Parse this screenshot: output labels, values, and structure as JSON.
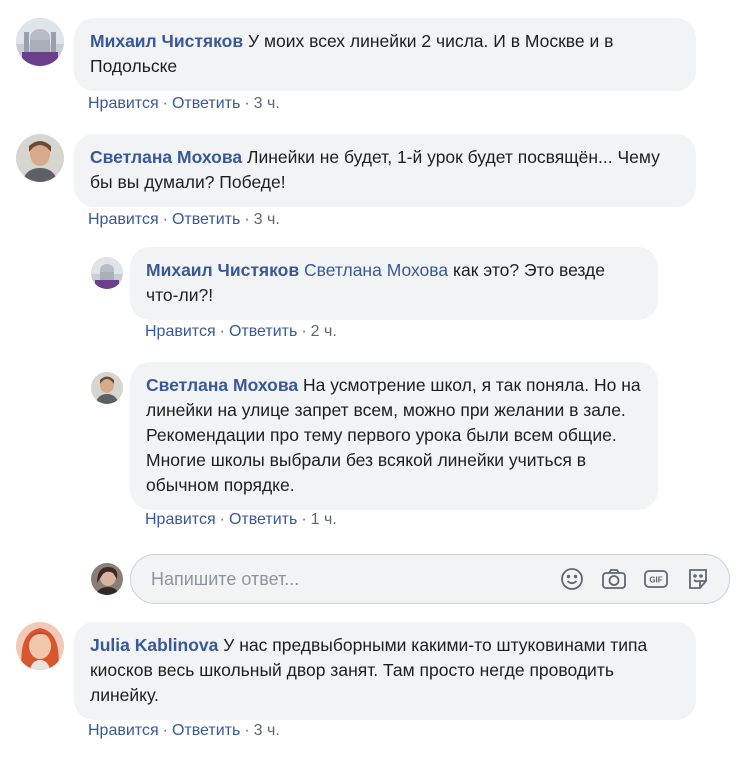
{
  "comments": [
    {
      "author": "Михаил Чистяков",
      "text": "У моих всех линейки 2 числа. И в Москве и в Подольске",
      "like": "Нравится",
      "reply": "Ответить",
      "time": "3 ч."
    },
    {
      "author": "Светлана Мохова",
      "text": "Линейки не будет, 1-й урок будет посвящён... Чему бы вы думали? Победе!",
      "like": "Нравится",
      "reply": "Ответить",
      "time": "3 ч."
    },
    {
      "author": "Julia Kablinova",
      "text": "У нас предвыборными какими-то штуковинами типа киосков весь школьный двор занят. Там просто негде проводить линейку.",
      "like": "Нравится",
      "reply": "Ответить",
      "time": "3 ч."
    }
  ],
  "replies": [
    {
      "author": "Михаил Чистяков",
      "tag": "Светлана Мохова",
      "text": "как это? Это везде что-ли?!",
      "like": "Нравится",
      "reply": "Ответить",
      "time": "2 ч."
    },
    {
      "author": "Светлана Мохова",
      "text": "На усмотрение школ, я так поняла. Но на линейки на улице запрет всем, можно при желании в зале. Рекомендации про тему первого урока были всем общие. Многие школы выбрали без всякой линейки учиться в обычном порядке.",
      "like": "Нравится",
      "reply": "Ответить",
      "time": "1 ч."
    }
  ],
  "reply_box": {
    "placeholder": "Напишите ответ..."
  },
  "separator": "·",
  "icons": [
    "emoji-icon",
    "camera-icon",
    "gif-icon",
    "sticker-icon"
  ],
  "colors": {
    "link": "#385898",
    "bubble": "#f2f3f5",
    "meta": "#606770",
    "text": "#1c1e21"
  }
}
